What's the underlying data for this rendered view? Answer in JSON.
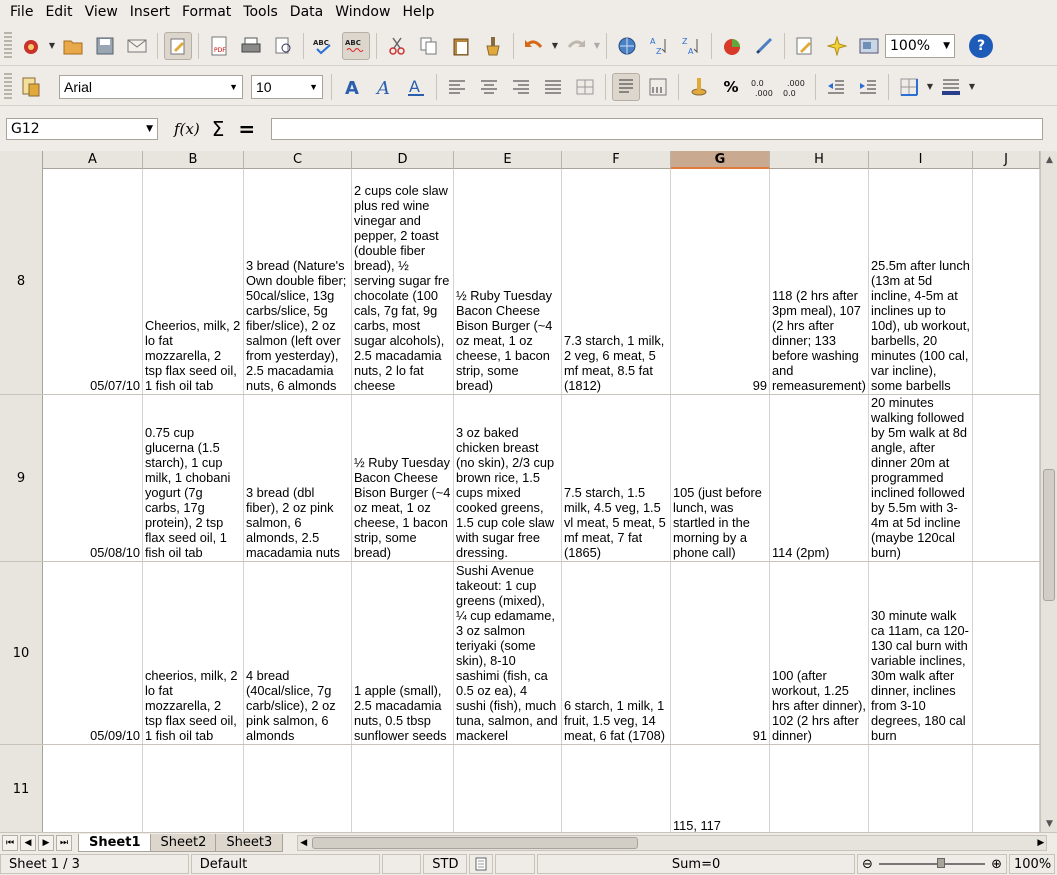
{
  "menu": {
    "items": [
      "File",
      "Edit",
      "View",
      "Insert",
      "Format",
      "Tools",
      "Data",
      "Window",
      "Help"
    ]
  },
  "toolbar": {
    "zoom": "100%",
    "font_name": "Arial",
    "font_size": "10",
    "help": "?"
  },
  "formula_bar": {
    "cell_ref": "G12",
    "fx": "f(x)",
    "sum": "Σ",
    "equals": "=",
    "value": ""
  },
  "columns": [
    "A",
    "B",
    "C",
    "D",
    "E",
    "F",
    "G",
    "H",
    "I",
    "J"
  ],
  "selected_column": "G",
  "rows": [
    {
      "num": "8",
      "cells": {
        "A": "05/07/10",
        "B": "Cheerios, milk, 2 lo fat mozzarella, 2 tsp flax seed oil, 1 fish oil tab",
        "C": "3 bread (Nature's Own double fiber; 50cal/slice, 13g carbs/slice, 5g fiber/slice), 2 oz salmon (left over from yesterday), 2.5 macadamia nuts, 6 almonds",
        "D": "2 cups cole slaw plus red wine vinegar and pepper, 2 toast (double fiber bread), ½ serving sugar fre chocolate (100 cals, 7g fat, 9g carbs, most sugar alcohols), 2.5 macadamia nuts, 2 lo fat cheese",
        "E": "½ Ruby Tuesday Bacon Cheese Bison Burger (~4 oz meat, 1 oz cheese, 1 bacon strip, some bread)",
        "F": "7.3 starch, 1 milk, 2 veg, 6 meat, 5 mf meat, 8.5 fat (1812)",
        "G": "99",
        "H": "118 (2 hrs after 3pm meal), 107 (2 hrs after dinner; 133 before washing and remeasurement)",
        "I": "25.5m after lunch (13m at 5d incline, 4-5m at inclines up to 10d), ub workout, barbells, 20 minutes (100 cal, var incline), some barbells",
        "J": ""
      }
    },
    {
      "num": "9",
      "cells": {
        "A": "05/08/10",
        "B": "0.75 cup glucerna (1.5 starch), 1 cup milk, 1 chobani yogurt (7g carbs, 17g protein), 2 tsp flax seed oil, 1 fish oil tab",
        "C": "3 bread (dbl fiber), 2 oz pink salmon, 6 almonds, 2.5 macadamia nuts",
        "D": "½ Ruby Tuesday Bacon Cheese Bison Burger (~4 oz meat, 1 oz cheese, 1 bacon strip, some bread)",
        "E": "3 oz baked chicken breast (no skin), 2/3 cup brown rice, 1.5 cups mixed cooked greens, 1.5 cup cole slaw with sugar free dressing.",
        "F": "7.5 starch, 1.5 milk, 4.5 veg, 1.5 vl meat, 5 meat, 5 mf meat, 7 fat (1865)",
        "G": "105 (just before lunch, was startled in the morning by a phone call)",
        "H": "114 (2pm)",
        "I": "20 minutes walking followed by 5m walk at 8d angle, after dinner 20m at programmed inclined followed by 5.5m with 3-4m at 5d incline (maybe 120cal burn)",
        "J": ""
      }
    },
    {
      "num": "10",
      "cells": {
        "A": "05/09/10",
        "B": "cheerios, milk, 2 lo fat mozzarella, 2 tsp flax seed oil, 1 fish oil tab",
        "C": "4 bread (40cal/slice, 7g carb/slice), 2 oz pink salmon, 6 almonds",
        "D": "1 apple (small), 2.5 macadamia nuts, 0.5 tbsp sunflower  seeds",
        "E": "Sushi Avenue takeout: 1 cup greens (mixed), ¼ cup edamame, 3 oz salmon teriyaki (some skin), 8-10 sashimi (fish, ca 0.5 oz ea), 4 sushi (fish), much tuna, salmon, and mackerel",
        "F": "6 starch, 1 milk, 1 fruit, 1.5 veg, 14 meat, 6 fat (1708)",
        "G": "91",
        "H": "100 (after workout, 1.25 hrs after dinner), 102 (2 hrs after dinner)",
        "I": "30 minute walk ca 11am, ca 120-130 cal burn with variable inclines, 30m walk after dinner, inclines from 3-10 degrees, 180 cal burn",
        "J": ""
      }
    },
    {
      "num": "11",
      "cells": {
        "A": "",
        "B": "",
        "C": "",
        "D": "",
        "E": "",
        "F": "",
        "G": "115, 117",
        "H": "",
        "I": "",
        "J": ""
      }
    }
  ],
  "sheets": [
    "Sheet1",
    "Sheet2",
    "Sheet3"
  ],
  "status": {
    "sheet_info": "Sheet 1 / 3",
    "style": "Default",
    "mode": "STD",
    "sum": "Sum=0",
    "zoom": "100%"
  }
}
